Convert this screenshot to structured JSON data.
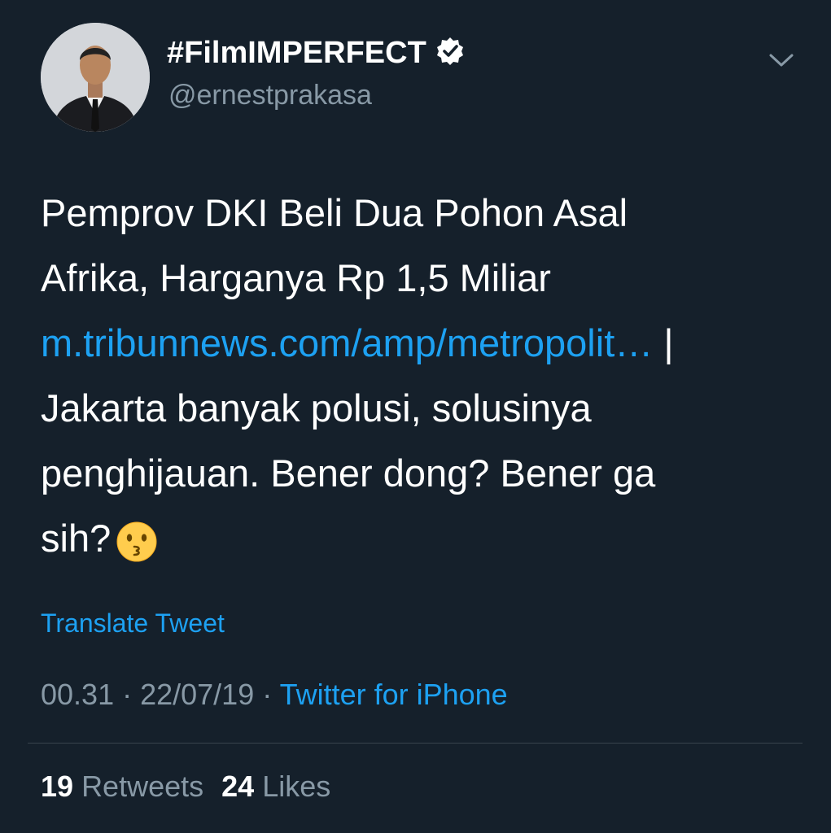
{
  "tweet": {
    "display_name": "#FilmIMPERFECT",
    "handle": "@ernestprakasa",
    "verified": true,
    "text_lines": [
      "Pemprov DKI Beli Dua Pohon Asal",
      "Afrika, Harganya Rp 1,5 Miliar",
      "Jakarta banyak polusi, solusinya",
      "penghijauan. Bener dong? Bener ga",
      "sih?"
    ],
    "link_text": "m.tribunnews.com/amp/metropolit…",
    "link_suffix": " |",
    "emoji": "kissing-face",
    "translate_label": "Translate Tweet",
    "time": "00.31",
    "date": "22/07/19",
    "separator": " · ",
    "source": "Twitter for iPhone",
    "retweets_count": "19",
    "retweets_label": "Retweets",
    "likes_count": "24",
    "likes_label": "Likes"
  },
  "colors": {
    "background": "#15202b",
    "text": "#ffffff",
    "secondary": "#8899a6",
    "accent": "#1da1f2",
    "divider": "#38444d"
  },
  "icons": {
    "verified": "verified-badge-icon",
    "menu": "chevron-down-icon"
  }
}
